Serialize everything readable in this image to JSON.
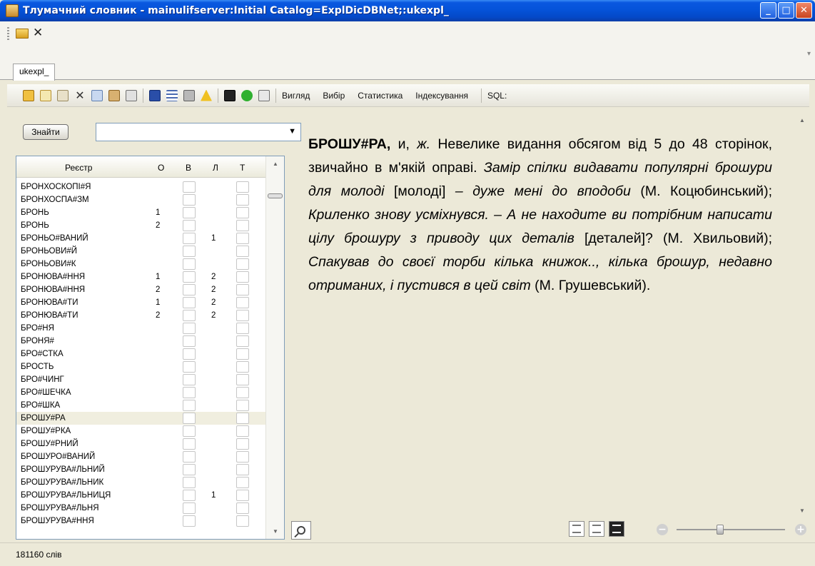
{
  "window": {
    "title": "Тлумачний словник - mainulifserver:Initial Catalog=ExplDicDBNet;:ukexpl_",
    "minimize_label": "_",
    "maximize_label": "□",
    "close_label": "✕"
  },
  "quick_toolbar": {
    "close_glyph": "✕"
  },
  "tab": {
    "label": "ukexpl_"
  },
  "toolbar": {
    "menus": [
      "Вигляд",
      "Вибір",
      "Статистика",
      "Індексування",
      "SQL:"
    ],
    "icons": [
      "new-entry-icon",
      "edit-icon",
      "edit-alt-icon",
      "delete-icon",
      "copy-icon",
      "paste-icon",
      "clipboard-icon",
      "save-icon",
      "list-icon",
      "print-icon",
      "warning-icon",
      "export-icon",
      "refresh-icon",
      "page-icon"
    ]
  },
  "search": {
    "button_label": "Знайти",
    "value": ""
  },
  "grid": {
    "headers": {
      "word": "Реєстр",
      "o": "О",
      "b": "В",
      "l": "Л",
      "t": "Т"
    },
    "rows": [
      {
        "word": "БРОНХОСКОПІ#Я",
        "o": "",
        "l": ""
      },
      {
        "word": "БРОНХОСПА#ЗМ",
        "o": "",
        "l": ""
      },
      {
        "word": "БРОНЬ",
        "o": "1",
        "l": ""
      },
      {
        "word": "БРОНЬ",
        "o": "2",
        "l": ""
      },
      {
        "word": "БРОНЬО#ВАНИЙ",
        "o": "",
        "l": "1"
      },
      {
        "word": "БРОНЬОВИ#Й",
        "o": "",
        "l": ""
      },
      {
        "word": "БРОНЬОВИ#К",
        "o": "",
        "l": ""
      },
      {
        "word": "БРОНЮВА#ННЯ",
        "o": "1",
        "l": "2"
      },
      {
        "word": "БРОНЮВА#ННЯ",
        "o": "2",
        "l": "2"
      },
      {
        "word": "БРОНЮВА#ТИ",
        "o": "1",
        "l": "2"
      },
      {
        "word": "БРОНЮВА#ТИ",
        "o": "2",
        "l": "2"
      },
      {
        "word": "БРО#НЯ",
        "o": "",
        "l": ""
      },
      {
        "word": "БРОНЯ#",
        "o": "",
        "l": ""
      },
      {
        "word": "БРО#СТКА",
        "o": "",
        "l": ""
      },
      {
        "word": "БРОСТЬ",
        "o": "",
        "l": ""
      },
      {
        "word": "БРО#ЧИНГ",
        "o": "",
        "l": ""
      },
      {
        "word": "БРО#ШЕЧКА",
        "o": "",
        "l": ""
      },
      {
        "word": "БРО#ШКА",
        "o": "",
        "l": ""
      },
      {
        "word": "БРОШУ#РА",
        "o": "",
        "l": ""
      },
      {
        "word": "БРОШУ#РКА",
        "o": "",
        "l": ""
      },
      {
        "word": "БРОШУ#РНИЙ",
        "o": "",
        "l": ""
      },
      {
        "word": "БРОШУРО#ВАНИЙ",
        "o": "",
        "l": ""
      },
      {
        "word": "БРОШУРУВА#ЛЬНИЙ",
        "o": "",
        "l": ""
      },
      {
        "word": "БРОШУРУВА#ЛЬНИК",
        "o": "",
        "l": ""
      },
      {
        "word": "БРОШУРУВА#ЛЬНИЦЯ",
        "o": "",
        "l": "1"
      },
      {
        "word": "БРОШУРУВА#ЛЬНЯ",
        "o": "",
        "l": ""
      },
      {
        "word": "БРОШУРУВА#ННЯ",
        "o": "",
        "l": ""
      }
    ],
    "selected_index": 18
  },
  "article": {
    "headword": "БРОШУ#РА,",
    "grammar": " и, ",
    "gender": "ж.",
    "definition": " Невелике видання обсягом від 5 до 48 сторінок, звичайно в м'якій оправі. ",
    "ex1": "Замір спілки видавати популярні брошури для молоді",
    "ex1_var": " [молоді] ",
    "ex1_b": "– дуже мені до вподоби",
    "src1": " (М. Коцюбинський); ",
    "ex2": "Криленко знову усміхнувся. – А не находите ви потрібним написати цілу брошуру з приводу цих деталів",
    "ex2_var": " [деталей]? ",
    "src2": "(М. Хвильовий); ",
    "ex3": "Спакував до своєї торби кілька книжок.., кілька брошур, недавно отриманих, і пустився в цей світ",
    "src3": " (М. Грушевський)."
  },
  "zoom": {
    "level": 0.4
  },
  "status": {
    "word_count": "181160 слів"
  }
}
